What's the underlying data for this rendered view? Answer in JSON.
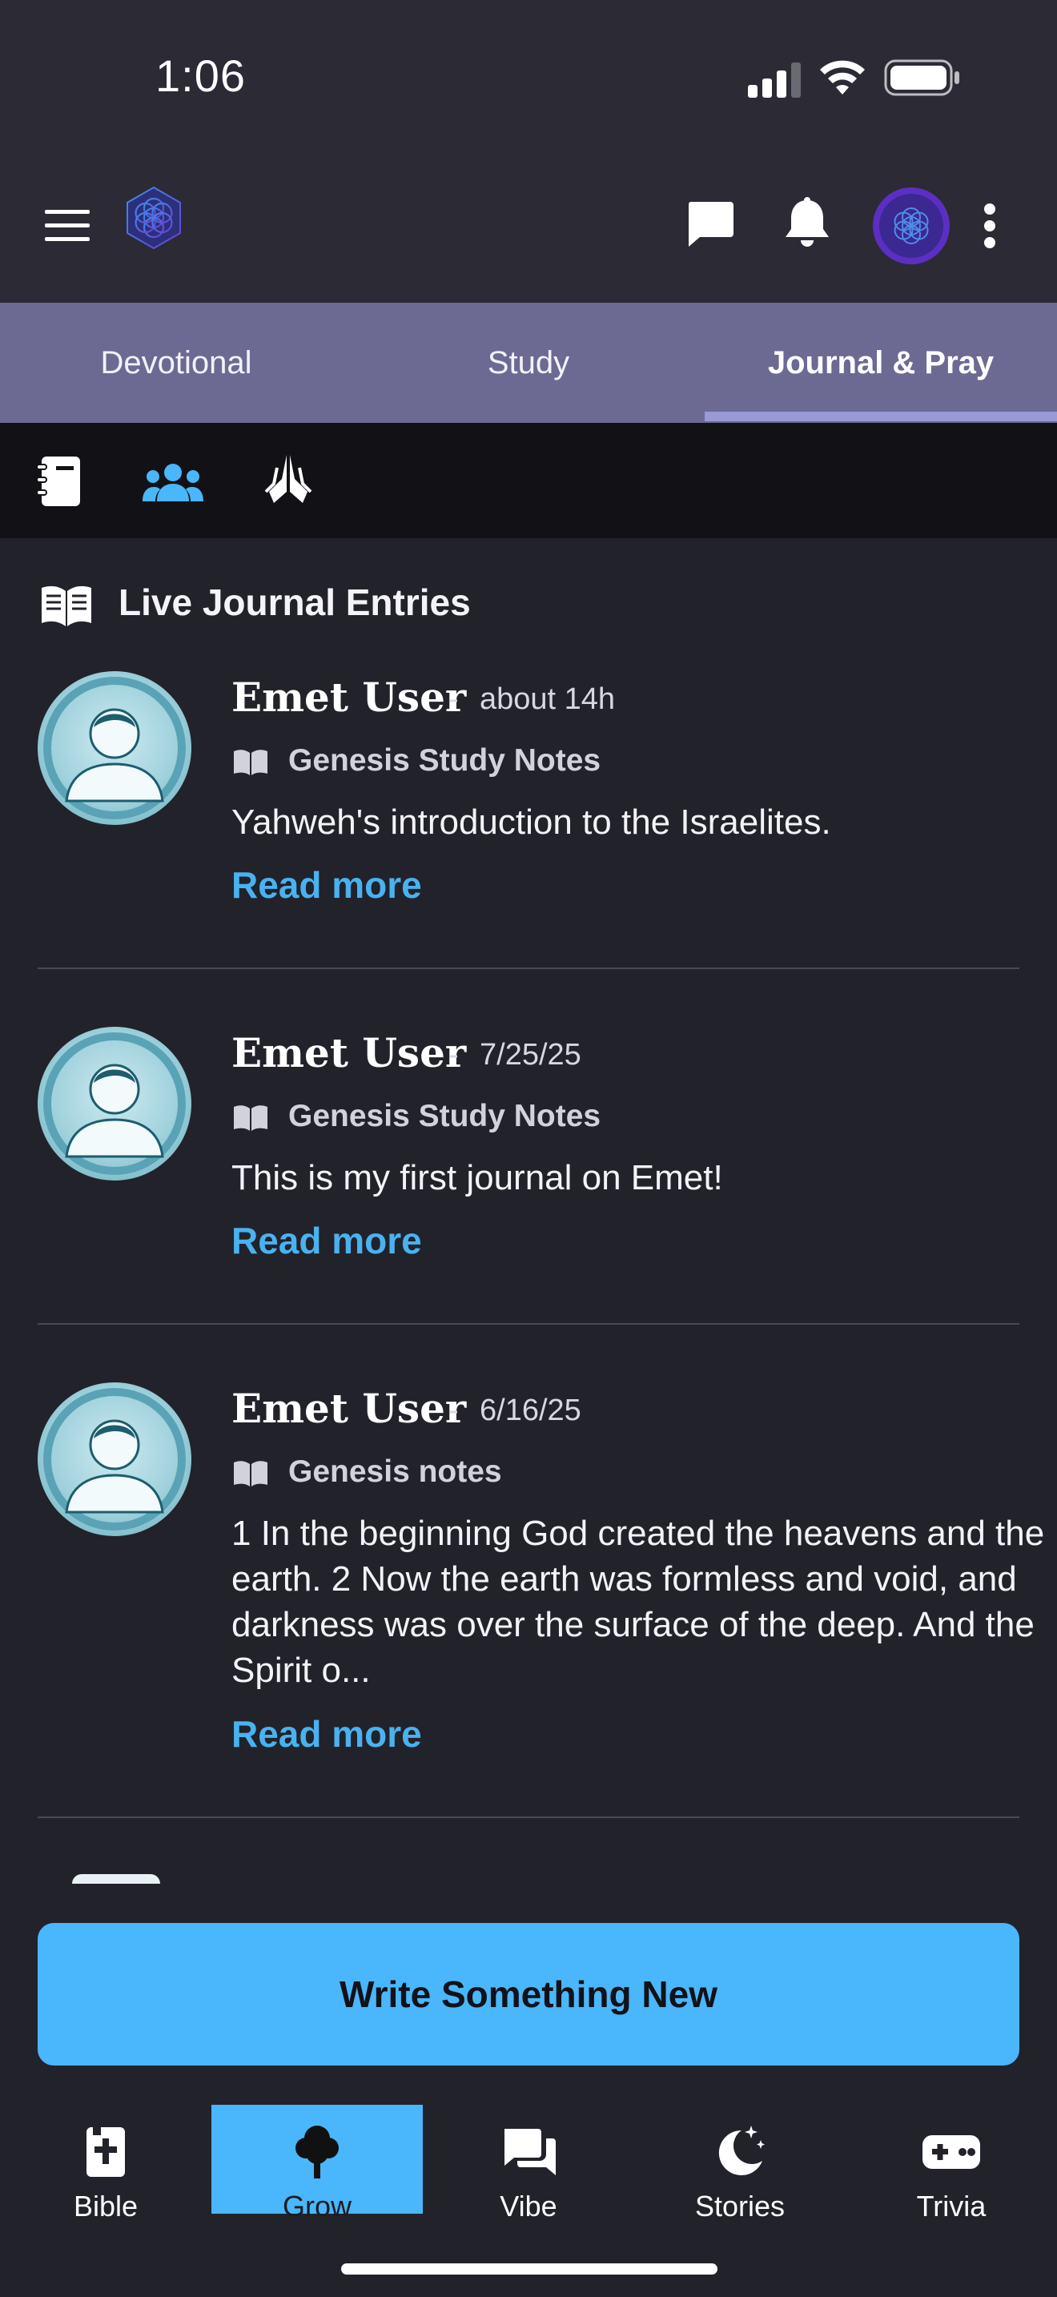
{
  "status_bar": {
    "time": "1:06"
  },
  "header": {
    "menu_icon": "hamburger-menu-icon",
    "logo_icon": "flower-of-life-logo",
    "chat_icon": "chat-bubble-icon",
    "bell_icon": "bell-icon",
    "profile_icon": "profile-avatar",
    "more_icon": "vertical-dots-icon"
  },
  "tabs": [
    {
      "label": "Devotional",
      "active": false
    },
    {
      "label": "Study",
      "active": false
    },
    {
      "label": "Journal & Pray",
      "active": true
    }
  ],
  "subnav": {
    "items": [
      "journal-book-icon",
      "community-group-icon",
      "praying-hands-icon"
    ],
    "active_index": 1
  },
  "section": {
    "title": "Live Journal Entries",
    "icon": "open-book-icon"
  },
  "entries": [
    {
      "user": "Emet User",
      "date": "about 14h",
      "book": "Genesis Study Notes",
      "text": "Yahweh's introduction to the Israelites.",
      "read_more": "Read more"
    },
    {
      "user": "Emet User",
      "date": "7/25/25",
      "book": "Genesis Study Notes",
      "text": "This is my first journal on Emet!",
      "read_more": "Read more"
    },
    {
      "user": "Emet User",
      "date": "6/16/25",
      "book": "Genesis notes",
      "text": "1 In the beginning God created the heavens and the\nearth. 2 Now the earth was formless and void, and\ndarkness was over the surface of the deep. And the\nSpirit o...",
      "read_more": "Read more"
    }
  ],
  "separator": "-",
  "cta": {
    "label": "Write Something New"
  },
  "bottom_nav": [
    {
      "label": "Bible",
      "icon": "bible-cross-icon",
      "active": false
    },
    {
      "label": "Grow",
      "icon": "tree-icon",
      "active": true
    },
    {
      "label": "Vibe",
      "icon": "chat-bubbles-icon",
      "active": false
    },
    {
      "label": "Stories",
      "icon": "moon-stars-icon",
      "active": false
    },
    {
      "label": "Trivia",
      "icon": "gamepad-icon",
      "active": false
    }
  ],
  "colors": {
    "accent": "#4ab6fb",
    "tab_bar": "#6c6a93",
    "background": "#22222b",
    "link": "#49b2f0"
  }
}
